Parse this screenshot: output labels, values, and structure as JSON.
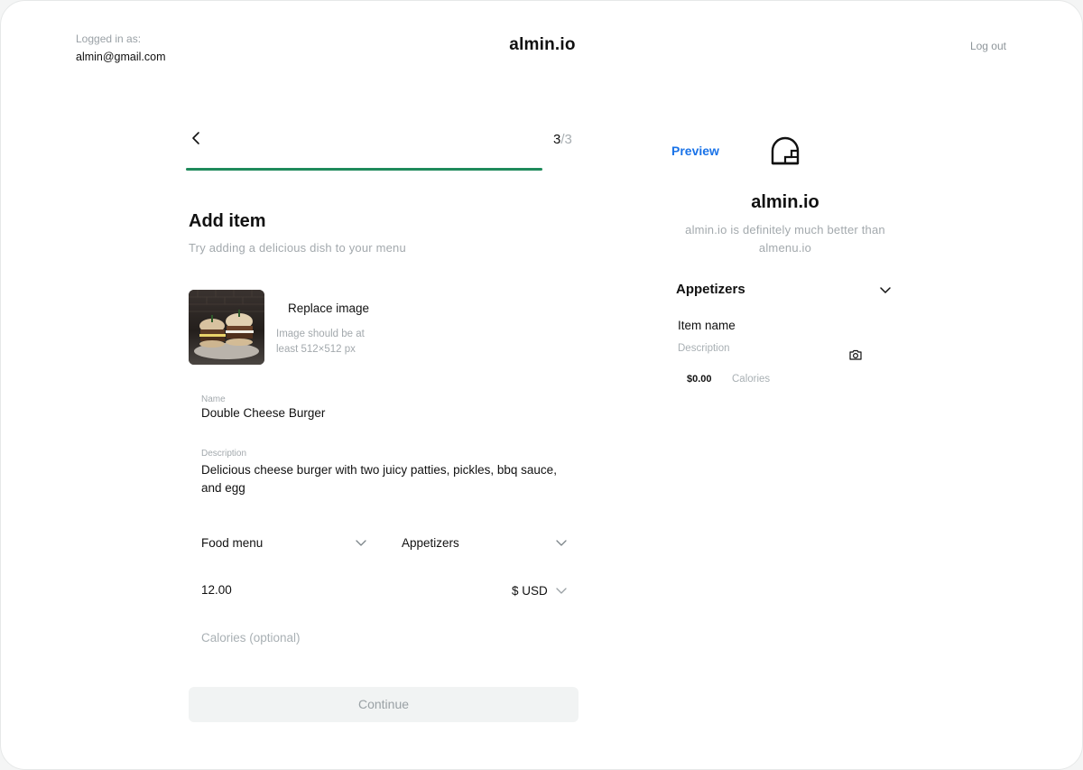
{
  "header": {
    "logged_in_label": "Logged in as:",
    "email": "almin@gmail.com",
    "brand": "almin.io",
    "logout": "Log out"
  },
  "wizard": {
    "step_current": "3",
    "step_total": "/3",
    "progress": 1.0,
    "title": "Add item",
    "subtitle": "Try adding a delicious dish to your menu",
    "image": {
      "replace_label": "Replace image",
      "hint": "Image should be at least 512×512 px"
    },
    "name": {
      "label": "Name",
      "value": "Double Cheese Burger"
    },
    "description": {
      "label": "Description",
      "value": "Delicious cheese burger with two juicy patties, pickles, bbq sauce, and egg"
    },
    "menu_select": "Food menu",
    "category_select": "Appetizers",
    "price": "12.00",
    "currency": "$ USD",
    "calories_placeholder": "Calories (optional)",
    "continue_label": "Continue"
  },
  "preview": {
    "label": "Preview",
    "brand": "almin.io",
    "description": "almin.io is definitely much better than almenu.io",
    "category": "Appetizers",
    "item_name": "Item name",
    "item_description": "Description",
    "price": "$0.00",
    "calories": "Calories"
  },
  "colors": {
    "accent_green": "#1f8a5b",
    "link_blue": "#1a73e8"
  }
}
